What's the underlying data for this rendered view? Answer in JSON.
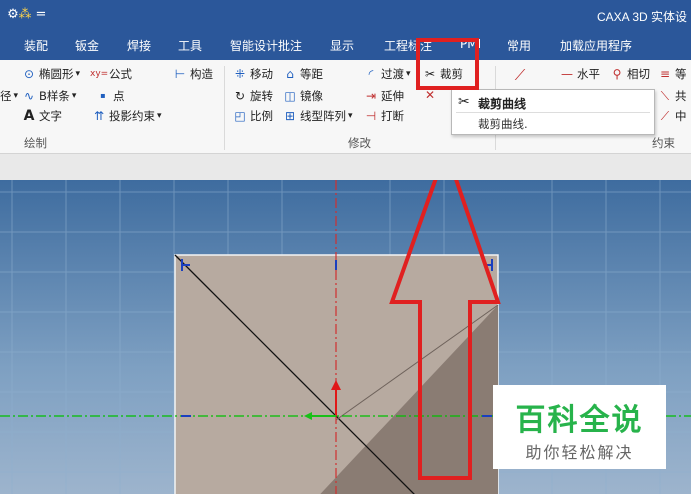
{
  "window": {
    "title": "CAXA 3D 实体设"
  },
  "quick_access": {
    "item1": "⚙",
    "item2": "⁂",
    "item3": "="
  },
  "tabs": [
    "装配",
    "钣金",
    "焊接",
    "工具",
    "智能设计批注",
    "显示",
    "工程标注",
    "PMI",
    "常用",
    "加载应用程序"
  ],
  "ribbon": {
    "draw": {
      "group_label": "绘制",
      "ellipse": "椭圆形",
      "formula": "公式",
      "construct": "构造",
      "diameter_prefix": "径",
      "bspline": "B样条",
      "point": "点",
      "text": "文字",
      "projection": "投影约束"
    },
    "modify": {
      "group_label": "修改",
      "move": "移动",
      "offset": "等距",
      "transition": "过渡",
      "trim": "裁剪",
      "rotate": "旋转",
      "mirror": "镜像",
      "extend": "延伸",
      "scale": "比例",
      "linear_array": "线型阵列",
      "break": "打断"
    },
    "constraint": {
      "group_label": "约束",
      "horizontal": "水平",
      "tangent": "相切",
      "equal_prefix": "等",
      "coincide_prefix": "共",
      "midpoint_prefix": "中"
    }
  },
  "tooltip": {
    "title": "裁剪曲线",
    "description": "裁剪曲线."
  },
  "annotation": {
    "highlight_color": "#e02020"
  },
  "watermark": {
    "line1": "百科全说",
    "line2": "助你轻松解决"
  },
  "colors": {
    "accent": "#2b579a",
    "green_line": "#00c000",
    "red_axis": "#d03030",
    "arrow": "#e02020",
    "watermark_green": "#27b34b"
  }
}
